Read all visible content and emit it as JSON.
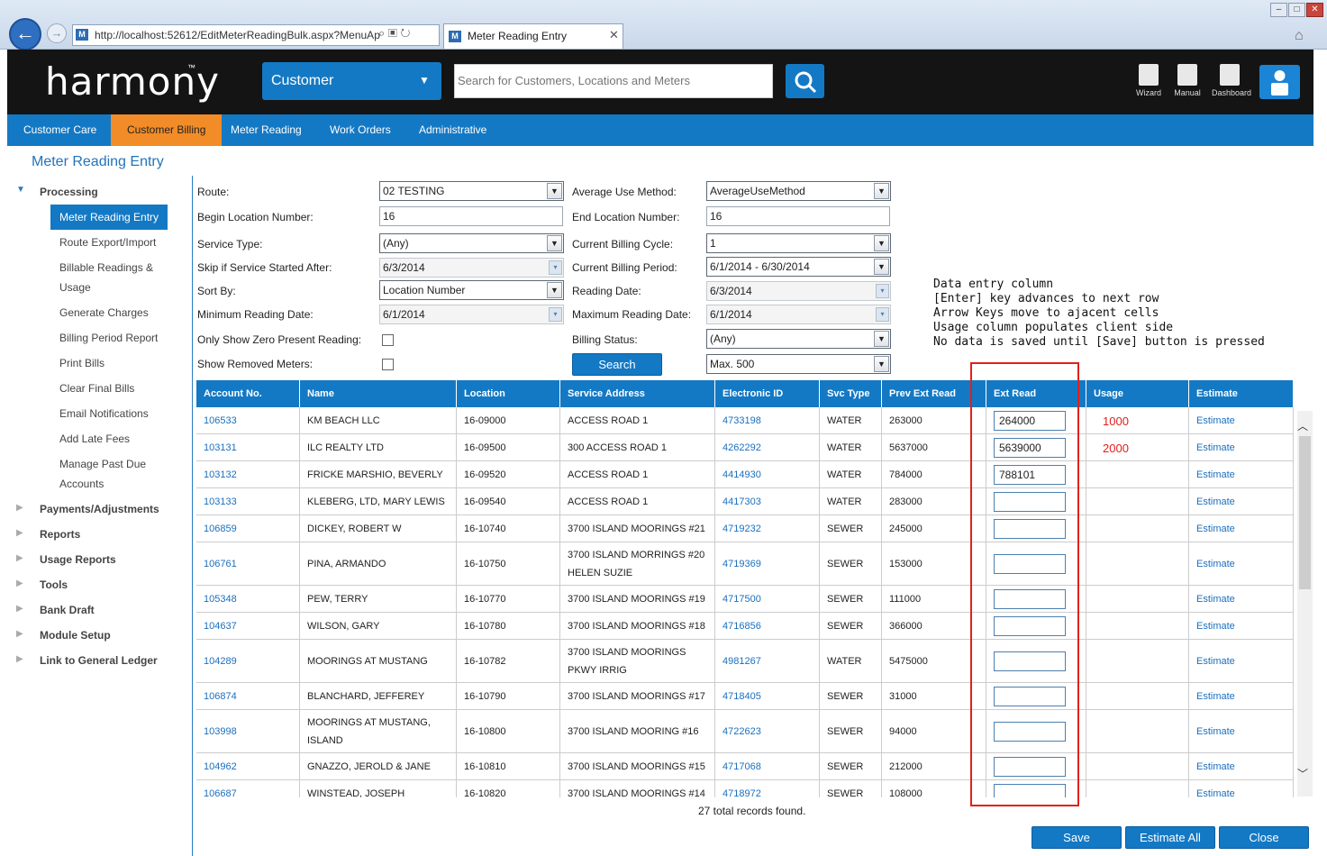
{
  "browser": {
    "url": "http://localhost:52612/EditMeterReadingBulk.aspx?MenuAp",
    "tab_title": "Meter Reading Entry",
    "back_glyph": "←",
    "fwd_glyph": "→",
    "close_glyph": "✕"
  },
  "header": {
    "logo": "harmony",
    "logo_tm": "™",
    "entity_select": "Customer",
    "search_placeholder": "Search for Customers, Locations and Meters",
    "icons": [
      {
        "name": "wizard-icon",
        "label": "Wizard"
      },
      {
        "name": "manual-icon",
        "label": "Manual"
      },
      {
        "name": "dashboard-icon",
        "label": "Dashboard"
      }
    ]
  },
  "nav": {
    "items": [
      "Customer Care",
      "Customer Billing",
      "Meter Reading",
      "Work Orders",
      "Administrative"
    ],
    "active": "Customer Billing"
  },
  "page_title": "Meter Reading Entry",
  "sidebar": {
    "groups": [
      "Processing",
      "Payments/Adjustments",
      "Reports",
      "Usage Reports",
      "Tools",
      "Bank Draft",
      "Module Setup",
      "Link to General Ledger"
    ],
    "processing_items": [
      "Meter Reading Entry",
      "Route Export/Import",
      "Billable Readings & Usage",
      "Generate Charges",
      "Billing Period Report",
      "Print Bills",
      "Clear Final Bills",
      "Email Notifications",
      "Add Late Fees",
      "Manage Past Due Accounts"
    ],
    "active_item": "Meter Reading Entry"
  },
  "form": {
    "route_label": "Route:",
    "route": "02 TESTING",
    "begin_loc_label": "Begin Location Number:",
    "begin_loc": "16",
    "service_type_label": "Service Type:",
    "service_type": "(Any)",
    "skip_label": "Skip if Service Started After:",
    "skip_date": "6/3/2014",
    "sort_label": "Sort By:",
    "sort": "Location Number",
    "min_date_label": "Minimum Reading Date:",
    "min_date": "6/1/2014",
    "zero_label": "Only Show Zero Present Reading:",
    "removed_label": "Show Removed Meters:",
    "avg_label": "Average Use Method:",
    "avg": "AverageUseMethod",
    "end_loc_label": "End Location Number:",
    "end_loc": "16",
    "cycle_label": "Current Billing Cycle:",
    "cycle": "1",
    "period_label": "Current Billing Period:",
    "period": "6/1/2014 - 6/30/2014",
    "reading_date_label": "Reading Date:",
    "reading_date": "6/3/2014",
    "max_date_label": "Maximum Reading Date:",
    "max_date": "6/1/2014",
    "status_label": "Billing Status:",
    "status": "(Any)",
    "search_button": "Search",
    "max_rows": "Max. 500"
  },
  "note": "Data entry column\n[Enter] key advances to next row\nArrow Keys move to ajacent cells\nUsage column populates client side\nNo data is saved until [Save] button is pressed",
  "grid": {
    "columns": [
      "Account No.",
      "Name",
      "Location",
      "Service Address",
      "Electronic ID",
      "Svc Type",
      "Prev Ext Read",
      "Ext Read",
      "Usage",
      "Estimate"
    ],
    "rows": [
      {
        "account": "106533",
        "name": "KM BEACH LLC",
        "location": "16-09000",
        "address": "ACCESS ROAD 1",
        "eid": "4733198",
        "svc": "WATER",
        "prev": "263000",
        "ext": "264000",
        "usage": "1000",
        "estimate": "Estimate"
      },
      {
        "account": "103131",
        "name": "ILC REALTY LTD",
        "location": "16-09500",
        "address": "300 ACCESS ROAD 1",
        "eid": "4262292",
        "svc": "WATER",
        "prev": "5637000",
        "ext": "5639000",
        "usage": "2000",
        "estimate": "Estimate"
      },
      {
        "account": "103132",
        "name": "FRICKE MARSHIO, BEVERLY",
        "location": "16-09520",
        "address": "ACCESS ROAD 1",
        "eid": "4414930",
        "svc": "WATER",
        "prev": "784000",
        "ext": "788101",
        "usage": "",
        "estimate": "Estimate"
      },
      {
        "account": "103133",
        "name": "KLEBERG, LTD, MARY LEWIS",
        "location": "16-09540",
        "address": "ACCESS ROAD 1",
        "eid": "4417303",
        "svc": "WATER",
        "prev": "283000",
        "ext": "",
        "usage": "",
        "estimate": "Estimate"
      },
      {
        "account": "106859",
        "name": "DICKEY, ROBERT W",
        "location": "16-10740",
        "address": "3700 ISLAND MOORINGS #21",
        "eid": "4719232",
        "svc": "SEWER",
        "prev": "245000",
        "ext": "",
        "usage": "",
        "estimate": "Estimate"
      },
      {
        "account": "106761",
        "name": "PINA, ARMANDO",
        "location": "16-10750",
        "address": "3700 ISLAND MORRINGS #20 HELEN SUZIE",
        "eid": "4719369",
        "svc": "SEWER",
        "prev": "153000",
        "ext": "",
        "usage": "",
        "estimate": "Estimate"
      },
      {
        "account": "105348",
        "name": "PEW, TERRY",
        "location": "16-10770",
        "address": "3700 ISLAND MOORINGS #19",
        "eid": "4717500",
        "svc": "SEWER",
        "prev": "111000",
        "ext": "",
        "usage": "",
        "estimate": "Estimate"
      },
      {
        "account": "104637",
        "name": "WILSON, GARY",
        "location": "16-10780",
        "address": "3700 ISLAND MOORINGS #18",
        "eid": "4716856",
        "svc": "SEWER",
        "prev": "366000",
        "ext": "",
        "usage": "",
        "estimate": "Estimate"
      },
      {
        "account": "104289",
        "name": "MOORINGS AT MUSTANG",
        "location": "16-10782",
        "address": "3700 ISLAND MOORINGS PKWY IRRIG",
        "eid": "4981267",
        "svc": "WATER",
        "prev": "5475000",
        "ext": "",
        "usage": "",
        "estimate": "Estimate"
      },
      {
        "account": "106874",
        "name": "BLANCHARD, JEFFEREY",
        "location": "16-10790",
        "address": "3700 ISLAND MOORINGS #17",
        "eid": "4718405",
        "svc": "SEWER",
        "prev": "31000",
        "ext": "",
        "usage": "",
        "estimate": "Estimate"
      },
      {
        "account": "103998",
        "name": "MOORINGS AT MUSTANG, ISLAND",
        "location": "16-10800",
        "address": "3700 ISLAND MOORING #16",
        "eid": "4722623",
        "svc": "SEWER",
        "prev": "94000",
        "ext": "",
        "usage": "",
        "estimate": "Estimate"
      },
      {
        "account": "104962",
        "name": "GNAZZO, JEROLD & JANE",
        "location": "16-10810",
        "address": "3700 ISLAND MOORINGS #15",
        "eid": "4717068",
        "svc": "SEWER",
        "prev": "212000",
        "ext": "",
        "usage": "",
        "estimate": "Estimate"
      },
      {
        "account": "106687",
        "name": "WINSTEAD, JOSEPH",
        "location": "16-10820",
        "address": "3700 ISLAND MOORINGS #14",
        "eid": "4718972",
        "svc": "SEWER",
        "prev": "108000",
        "ext": "",
        "usage": "",
        "estimate": "Estimate"
      }
    ],
    "total": "27 total records found."
  },
  "buttons": {
    "save": "Save",
    "estimate_all": "Estimate All",
    "close": "Close"
  },
  "colors": {
    "brand_blue": "#1479c4",
    "active_orange": "#f28c28",
    "highlight_red": "#e0201c"
  }
}
